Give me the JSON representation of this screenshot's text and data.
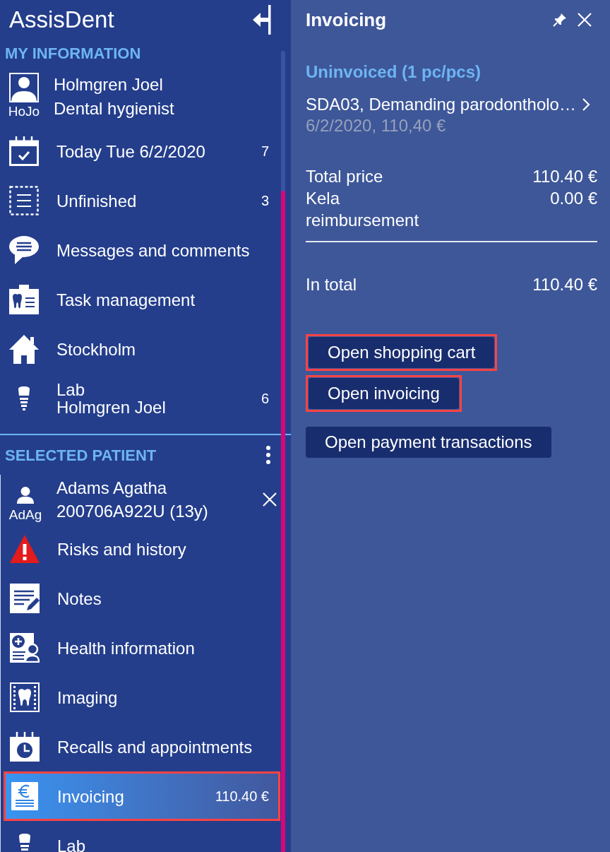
{
  "app": {
    "title": "AssisDent"
  },
  "my_information": {
    "heading": "MY INFORMATION",
    "user": {
      "initials": "HoJo",
      "name": "Holmgren Joel",
      "role": "Dental hygienist"
    },
    "items": [
      {
        "label": "Today Tue 6/2/2020",
        "count": "7",
        "selected": false,
        "highlighted": false
      },
      {
        "label": "Unfinished",
        "count": "3",
        "selected": false,
        "highlighted": false
      },
      {
        "label": "Messages and comments",
        "selected": false,
        "highlighted": false
      },
      {
        "label": "Task management",
        "selected": false,
        "highlighted": false
      },
      {
        "label": "Stockholm",
        "selected": false,
        "highlighted": false
      },
      {
        "label": "Lab",
        "sublabel": "Holmgren Joel",
        "count": "6",
        "selected": false,
        "highlighted": false
      }
    ]
  },
  "selected_patient": {
    "heading": "SELECTED PATIENT",
    "patient": {
      "initials": "AdAg",
      "name": "Adams Agatha",
      "id": "200706A922U (13y)"
    },
    "items": [
      {
        "label": "Risks and history",
        "selected": false,
        "highlighted": false
      },
      {
        "label": "Notes",
        "selected": false,
        "highlighted": false
      },
      {
        "label": "Health information",
        "selected": false,
        "highlighted": false
      },
      {
        "label": "Imaging",
        "selected": false,
        "highlighted": false
      },
      {
        "label": "Recalls and appointments",
        "selected": false,
        "highlighted": false
      },
      {
        "label": "Invoicing",
        "count": "110.40 €",
        "selected": true,
        "highlighted": true
      },
      {
        "label": "Lab",
        "selected": false,
        "highlighted": false
      }
    ]
  },
  "invoicing_panel": {
    "title": "Invoicing",
    "uninvoiced": {
      "heading": "Uninvoiced (1 pc/pcs)",
      "entries": [
        {
          "title": "SDA03, Demanding parodontholo…",
          "detail": "6/2/2020, 110,40 €"
        }
      ]
    },
    "totals": [
      {
        "label": "Total price",
        "value": "110.40 €"
      },
      {
        "label": "Kela reimbursement",
        "value": "0.00 €"
      }
    ],
    "grand_total": {
      "label": "In total",
      "value": "110.40 €"
    },
    "buttons": [
      {
        "label": "Open shopping cart",
        "highlighted": true
      },
      {
        "label": "Open invoicing",
        "highlighted": true
      },
      {
        "label": "Open payment transactions",
        "highlighted": false
      }
    ]
  }
}
